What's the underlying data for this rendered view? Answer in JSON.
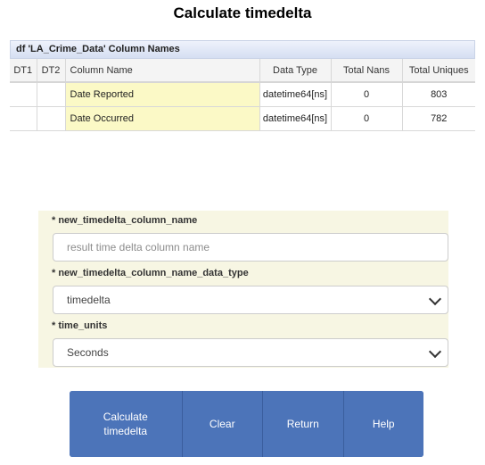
{
  "title": "Calculate timedelta",
  "table": {
    "caption": "df 'LA_Crime_Data' Column Names",
    "headers": [
      "DT1",
      "DT2",
      "Column Name",
      "Data Type",
      "Total Nans",
      "Total Uniques"
    ],
    "rows": [
      {
        "dt1": "",
        "dt2": "",
        "name": "Date Reported",
        "dtype": "datetime64[ns]",
        "nans": "0",
        "uniques": "803"
      },
      {
        "dt1": "",
        "dt2": "",
        "name": "Date Occurred",
        "dtype": "datetime64[ns]",
        "nans": "0",
        "uniques": "782"
      }
    ]
  },
  "form": {
    "field1": {
      "label": "* new_timedelta_column_name",
      "placeholder": "result time delta column name"
    },
    "field2": {
      "label": "* new_timedelta_column_name_data_type",
      "value": "timedelta"
    },
    "field3": {
      "label": "* time_units",
      "value": "Seconds"
    }
  },
  "buttons": {
    "calculate": "Calculate timedelta",
    "clear": "Clear",
    "return": "Return",
    "help": "Help"
  }
}
